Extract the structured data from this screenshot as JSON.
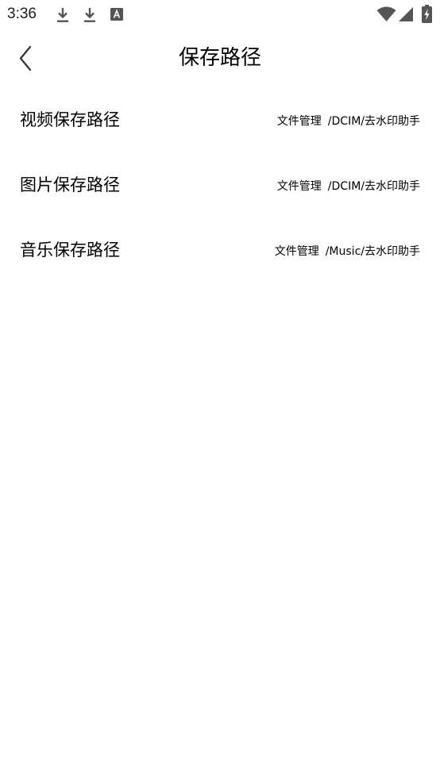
{
  "status_bar": {
    "time": "3:36",
    "icons": [
      "download-icon",
      "download-icon",
      "font-app-icon",
      "wifi-icon",
      "cellular-signal-icon",
      "battery-charging-icon"
    ]
  },
  "header": {
    "back_icon": "chevron-left-icon",
    "title": "保存路径"
  },
  "rows": [
    {
      "label": "视频保存路径",
      "location": "文件管理",
      "path": "/DCIM/去水印助手"
    },
    {
      "label": "图片保存路径",
      "location": "文件管理",
      "path": "/DCIM/去水印助手"
    },
    {
      "label": "音乐保存路径",
      "location": "文件管理",
      "path": "/Music/去水印助手"
    }
  ],
  "colors": {
    "background": "#ffffff",
    "text": "#000000",
    "status_icons": "#555555"
  }
}
